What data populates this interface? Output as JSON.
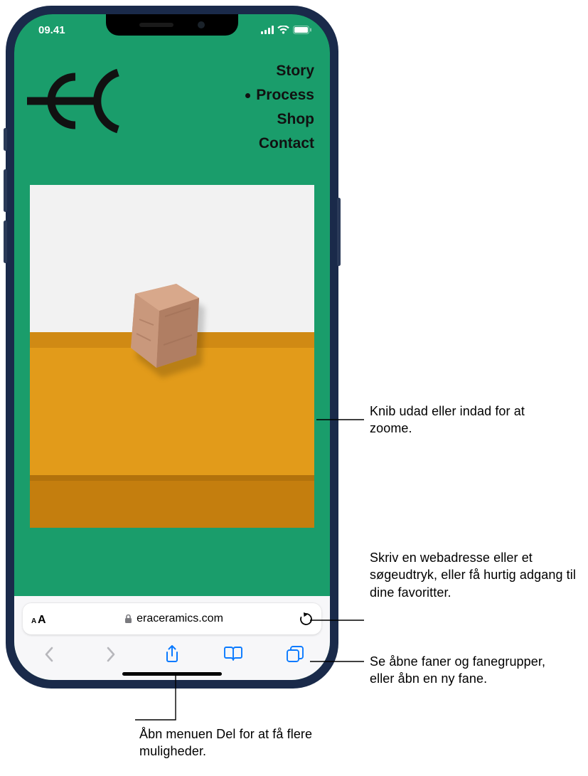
{
  "status": {
    "time": "09.41"
  },
  "site": {
    "nav": {
      "item1": "Story",
      "item2": "Process",
      "item3": "Shop",
      "item4": "Contact"
    }
  },
  "url_bar": {
    "domain": "eraceramics.com"
  },
  "callouts": {
    "zoom": "Knib udad eller indad for at zoome.",
    "address": "Skriv en webadresse eller et søgeudtryk, eller få hurtig adgang til dine favoritter.",
    "tabs": "Se åbne faner og fanegrupper, eller åbn en ny fane.",
    "share": "Åbn menuen Del for at få flere muligheder."
  }
}
